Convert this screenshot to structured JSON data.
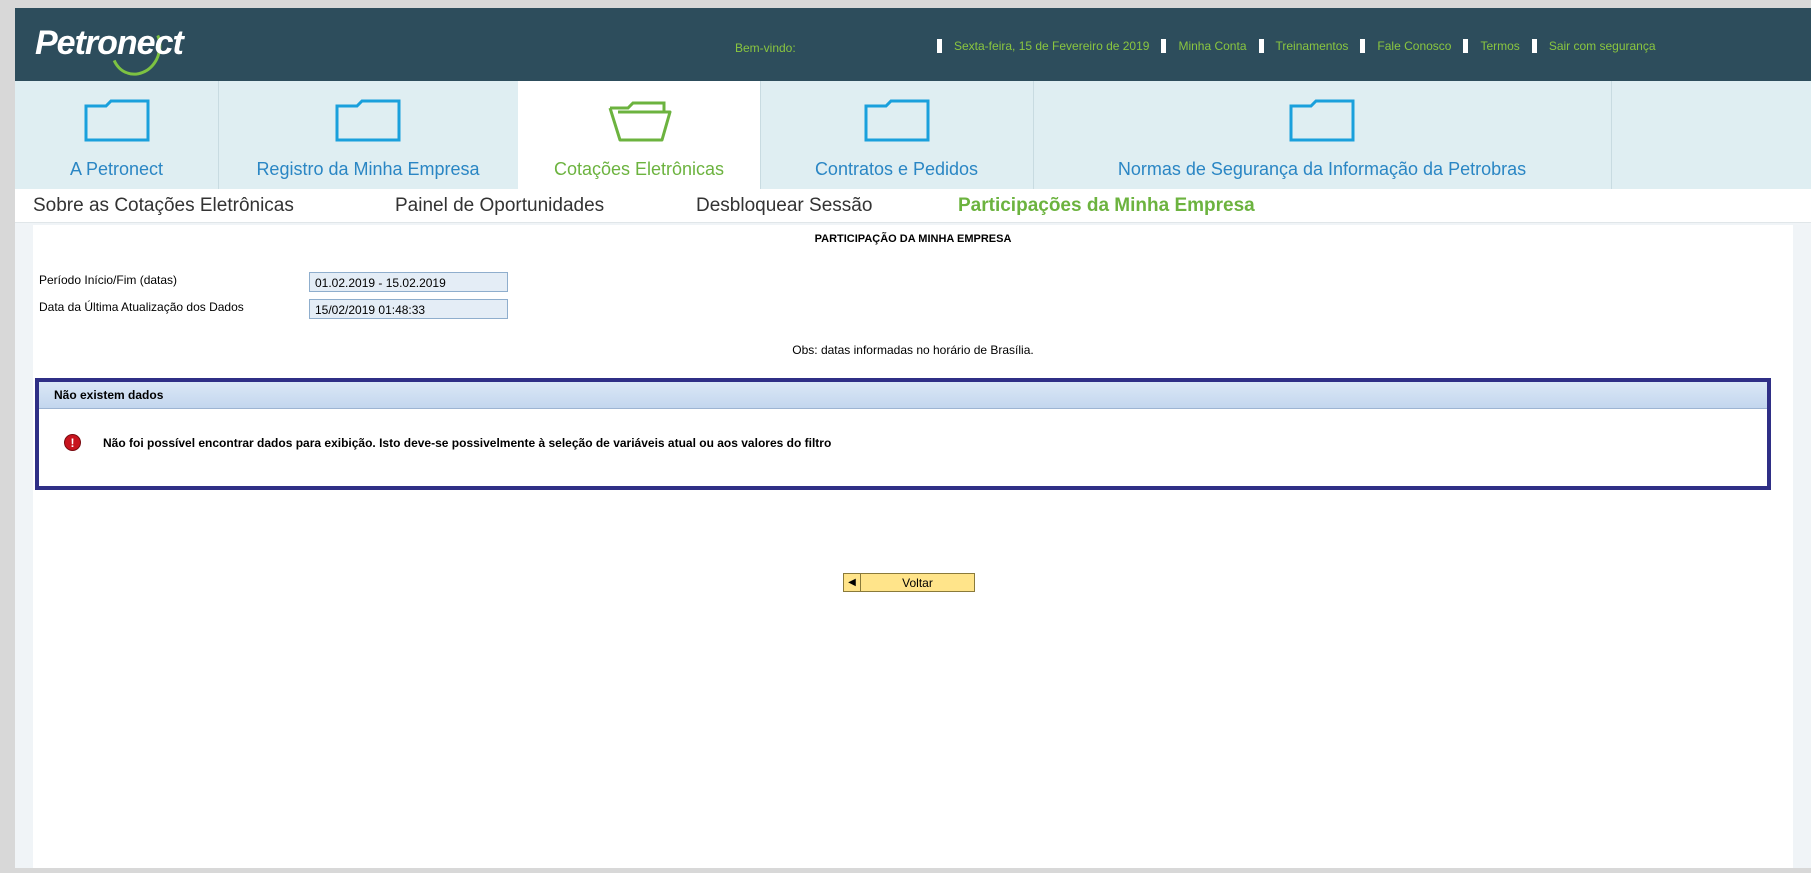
{
  "header": {
    "logo": "Petronect",
    "welcome": "Bem-vindo:",
    "date": "Sexta-feira, 15 de Fevereiro de 2019",
    "links": [
      "Minha Conta",
      "Treinamentos",
      "Fale Conosco",
      "Termos",
      "Sair com segurança"
    ]
  },
  "tabs": [
    {
      "label": "A Petronect"
    },
    {
      "label": "Registro da Minha Empresa"
    },
    {
      "label": "Cotações Eletrônicas"
    },
    {
      "label": "Contratos e Pedidos"
    },
    {
      "label": "Normas de Segurança da Informação da Petrobras"
    }
  ],
  "subnav": [
    "Sobre as Cotações Eletrônicas",
    "Painel de Oportunidades",
    "Desbloquear Sessão",
    "Participações da Minha Empresa"
  ],
  "page": {
    "title": "PARTICIPAÇÃO DA MINHA EMPRESA",
    "fields": [
      {
        "label": "Período Início/Fim (datas)",
        "value": "01.02.2019 - 15.02.2019"
      },
      {
        "label": "Data da Última Atualização dos Dados",
        "value": "15/02/2019 01:48:33"
      }
    ],
    "obs": "Obs: datas informadas no horário de Brasília.",
    "message": {
      "header": "Não existem dados",
      "text": "Não foi possível encontrar dados para exibição. Isto deve-se possivelmente à seleção de variáveis atual ou aos valores do filtro"
    },
    "back_button": "Voltar"
  },
  "colors": {
    "header_bg": "#2d4d5c",
    "accent_green": "#6cb33f",
    "tab_blue": "#2a86c4",
    "message_border": "#2f2f86",
    "button_bg": "#ffe48a"
  },
  "icons": {
    "tab_folder": "folder-icon",
    "active_tab_folder": "open-folder-icon",
    "error": "error-icon",
    "back": "arrow-left-icon"
  }
}
